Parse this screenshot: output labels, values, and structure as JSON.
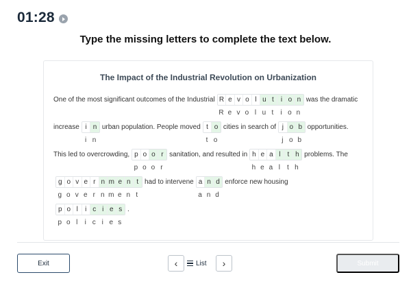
{
  "timer": {
    "value": "01:28",
    "icon": "play-circle-icon"
  },
  "instruction": "Type the missing letters to complete the text below.",
  "card": {
    "title": "The Impact of the Industrial Revolution on Urbanization"
  },
  "lines": [
    [
      {
        "t": "text",
        "v": "One of the most significant outcomes of the Industrial"
      },
      {
        "t": "word",
        "letters": [
          "R",
          "e",
          "v",
          "o",
          "l",
          "u",
          "t",
          "i",
          "o",
          "n"
        ],
        "given": 5,
        "answer": "Revolution"
      },
      {
        "t": "text",
        "v": "was the dramatic"
      }
    ],
    [
      {
        "t": "text",
        "v": "increase"
      },
      {
        "t": "word",
        "letters": [
          "i",
          "n"
        ],
        "given": 1,
        "answer": "in"
      },
      {
        "t": "text",
        "v": "urban population. People moved"
      },
      {
        "t": "word",
        "letters": [
          "t",
          "o"
        ],
        "given": 1,
        "answer": "to"
      },
      {
        "t": "text",
        "v": "cities in search of"
      },
      {
        "t": "word",
        "letters": [
          "j",
          "o",
          "b"
        ],
        "given": 1,
        "answer": "job"
      },
      {
        "t": "text",
        "v": "opportunities."
      }
    ],
    [
      {
        "t": "text",
        "v": "This led to overcrowding,"
      },
      {
        "t": "word",
        "letters": [
          "p",
          "o",
          "o",
          "r"
        ],
        "given": 2,
        "answer": "poor"
      },
      {
        "t": "text",
        "v": "sanitation, and resulted in"
      },
      {
        "t": "word",
        "letters": [
          "h",
          "e",
          "a",
          "l",
          "t",
          "h"
        ],
        "given": 3,
        "answer": "health"
      },
      {
        "t": "text",
        "v": "problems. The"
      }
    ],
    [
      {
        "t": "word",
        "letters": [
          "g",
          "o",
          "v",
          "e",
          "r",
          "n",
          "m",
          "e",
          "n",
          "t"
        ],
        "given": 5,
        "answer": "government"
      },
      {
        "t": "text",
        "v": "had to intervene"
      },
      {
        "t": "word",
        "letters": [
          "a",
          "n",
          "d"
        ],
        "given": 1,
        "answer": "and"
      },
      {
        "t": "text",
        "v": "enforce new housing"
      }
    ],
    [
      {
        "t": "word",
        "letters": [
          "p",
          "o",
          "l",
          "i",
          "c",
          "i",
          "e",
          "s"
        ],
        "given": 4,
        "answer": "policies"
      },
      {
        "t": "text",
        "v": "."
      }
    ]
  ],
  "footer": {
    "exit_label": "Exit",
    "prev_icon": "chevron-left-icon",
    "list_label": "List",
    "list_icon": "list-icon",
    "next_icon": "chevron-right-icon",
    "submit_label": "Submit"
  },
  "colors": {
    "missing_box": "#e4f6e7",
    "submit_disabled": "#e9ecef",
    "exit_border": "#2a4a6b"
  }
}
